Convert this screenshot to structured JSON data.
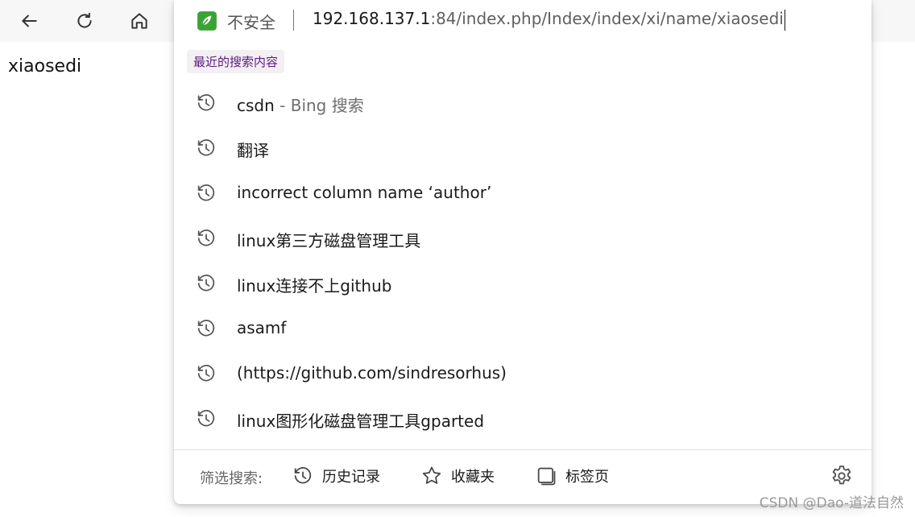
{
  "page": {
    "body_text": "xiaosedi"
  },
  "toolbar": {
    "back_icon": "arrow-left",
    "reload_icon": "reload",
    "home_icon": "home"
  },
  "address_bar": {
    "security_label": "不安全",
    "url_host": "192.168.137.1",
    "url_rest": ":84/index.php/Index/index/xi/name/xiaosedi"
  },
  "dropdown": {
    "recent_label": "最近的搜索内容",
    "suggestions": [
      {
        "text": "csdn",
        "suffix": " - Bing 搜索"
      },
      {
        "text": "翻译",
        "suffix": ""
      },
      {
        "text": "incorrect column name ‘author’",
        "suffix": ""
      },
      {
        "text": "linux第三方磁盘管理工具",
        "suffix": ""
      },
      {
        "text": "linux连接不上github",
        "suffix": ""
      },
      {
        "text": "asamf",
        "suffix": ""
      },
      {
        "text": "(https://github.com/sindresorhus)",
        "suffix": ""
      },
      {
        "text": "linux图形化磁盘管理工具gparted",
        "suffix": ""
      }
    ],
    "filter": {
      "label": "筛选搜索:",
      "history": "历史记录",
      "favorites": "收藏夹",
      "tabs": "标签页"
    }
  },
  "watermark": "CSDN @Dao-道法自然",
  "colors": {
    "accent_purple": "#5a1c80",
    "leaf_green": "#3aa335"
  }
}
